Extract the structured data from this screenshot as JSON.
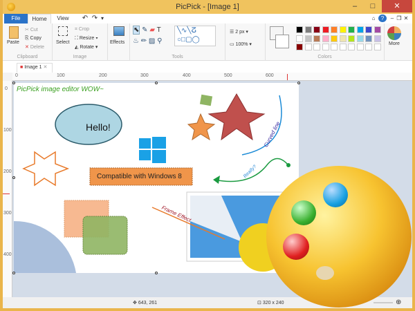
{
  "window": {
    "title": "PicPick - [Image 1]"
  },
  "tabs": [
    {
      "label": "File"
    },
    {
      "label": "Home"
    },
    {
      "label": "View"
    }
  ],
  "ribbon": {
    "clipboard": {
      "label": "Clipboard",
      "paste": "Paste",
      "cut": "Cut",
      "copy": "Copy",
      "delete": "Delete"
    },
    "image": {
      "label": "Image",
      "select": "Select",
      "crop": "Crop",
      "resize": "Resize",
      "rotate": "Rotate"
    },
    "effects": {
      "label": "Effects"
    },
    "tools": {
      "label": "Tools",
      "stroke": "2 px",
      "zoom": "100%"
    },
    "colors": {
      "label": "Colors",
      "more": "More",
      "row1": [
        "#000000",
        "#7f7f7f",
        "#880015",
        "#ed1c24",
        "#ff7f27",
        "#fff200",
        "#22b14c",
        "#00a2e8",
        "#3f48cc",
        "#a349a4"
      ],
      "row2": [
        "#ffffff",
        "#c3c3c3",
        "#b97a57",
        "#ffaec9",
        "#ffc90e",
        "#efe4b0",
        "#b5e61d",
        "#99d9ea",
        "#7092be",
        "#c8bfe7"
      ],
      "row3": [
        "#880000",
        "#ffffff",
        "#ffffff",
        "#ffffff",
        "#ffffff",
        "#ffffff",
        "#ffffff",
        "#ffffff",
        "#ffffff",
        "#ffffff"
      ]
    }
  },
  "doc_tab": {
    "label": "Image 1"
  },
  "ruler": {
    "h": [
      "0",
      "100",
      "200",
      "300",
      "400",
      "500",
      "600"
    ],
    "v": [
      "0",
      "100",
      "200",
      "300",
      "400"
    ]
  },
  "canvas": {
    "headline": "PicPick image editor WOW~",
    "bubble": "Hello!",
    "banner": "Compatible with Windows 8",
    "curved": "Curved line",
    "really": "Really?",
    "frame": "Frame Effect"
  },
  "status": {
    "cursor": "643, 261",
    "size": "320 x 240"
  }
}
